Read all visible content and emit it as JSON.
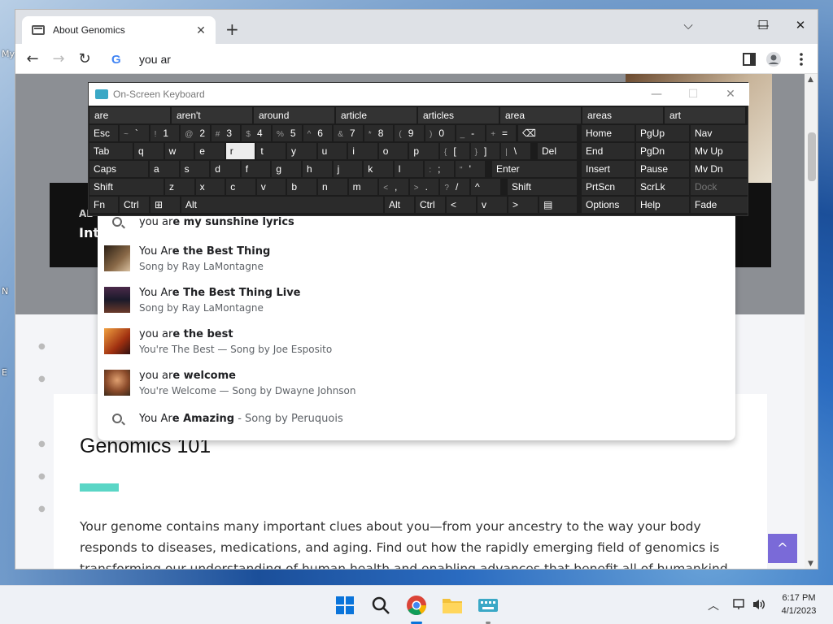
{
  "desktop": {
    "labels": [
      "My",
      "N",
      "E"
    ]
  },
  "browser": {
    "tab_title": "About Genomics",
    "omnibox_text": "you ar"
  },
  "page": {
    "hero_small": "AL",
    "hero_title": "Int",
    "heading": "Genomics 101",
    "body": "Your genome contains many important clues about you—from your ancestry to the way your body responds to diseases, medications, and aging. Find out how the rapidly emerging field of genomics is transforming our understanding of human health and enabling advances that benefit all of humankind."
  },
  "suggestions": [
    {
      "icon": "search-icon",
      "typed": "you ar",
      "rest": "e my sunshine lyrics",
      "sub": ""
    },
    {
      "icon": "thumbnail",
      "typed": "You Ar",
      "rest": "e the Best Thing",
      "sub": "Song by Ray LaMontagne",
      "color": "#6a4a30"
    },
    {
      "icon": "thumbnail",
      "typed": "You Ar",
      "rest": "e The Best Thing Live",
      "sub": "Song by Ray LaMontagne",
      "color": "#3a2a3a"
    },
    {
      "icon": "thumbnail",
      "typed": "you ar",
      "rest": "e the best",
      "sub": "You're The Best — Song by Joe Esposito",
      "color": "#c46a24"
    },
    {
      "icon": "thumbnail",
      "typed": "you ar",
      "rest": "e welcome",
      "sub": "You're Welcome — Song by Dwayne Johnson",
      "color": "#8a5a3a"
    },
    {
      "icon": "search-icon",
      "typed": "You Ar",
      "rest": "e Amazing",
      "inline_sub": " - Song by Peruquois",
      "sub": ""
    }
  ],
  "osk": {
    "title": "On-Screen Keyboard",
    "predictions": [
      "are",
      "aren't",
      "around",
      "article",
      "articles",
      "area",
      "areas",
      "art"
    ],
    "row1": [
      {
        "p": "Esc"
      },
      {
        "s": "~",
        "p": "`"
      },
      {
        "s": "!",
        "p": "1"
      },
      {
        "s": "@",
        "p": "2"
      },
      {
        "s": "#",
        "p": "3"
      },
      {
        "s": "$",
        "p": "4"
      },
      {
        "s": "%",
        "p": "5"
      },
      {
        "s": "^",
        "p": "6"
      },
      {
        "s": "&",
        "p": "7"
      },
      {
        "s": "*",
        "p": "8"
      },
      {
        "s": "(",
        "p": "9"
      },
      {
        "s": ")",
        "p": "0"
      },
      {
        "s": "_",
        "p": "-"
      },
      {
        "s": "+",
        "p": "="
      },
      {
        "p": "⌫"
      }
    ],
    "row2": [
      {
        "p": "Tab"
      },
      {
        "p": "q"
      },
      {
        "p": "w"
      },
      {
        "p": "e"
      },
      {
        "p": "r"
      },
      {
        "p": "t"
      },
      {
        "p": "y"
      },
      {
        "p": "u"
      },
      {
        "p": "i"
      },
      {
        "p": "o"
      },
      {
        "p": "p"
      },
      {
        "s": "{",
        "p": "["
      },
      {
        "s": "}",
        "p": "]"
      },
      {
        "s": "|",
        "p": "\\"
      },
      {
        "p": "Del"
      }
    ],
    "row3": [
      {
        "p": "Caps"
      },
      {
        "p": "a"
      },
      {
        "p": "s"
      },
      {
        "p": "d"
      },
      {
        "p": "f"
      },
      {
        "p": "g"
      },
      {
        "p": "h"
      },
      {
        "p": "j"
      },
      {
        "p": "k"
      },
      {
        "p": "l"
      },
      {
        "s": ":",
        "p": ";"
      },
      {
        "s": "\"",
        "p": "'"
      },
      {
        "p": "Enter"
      }
    ],
    "row4": [
      {
        "p": "Shift"
      },
      {
        "p": "z"
      },
      {
        "p": "x"
      },
      {
        "p": "c"
      },
      {
        "p": "v"
      },
      {
        "p": "b"
      },
      {
        "p": "n"
      },
      {
        "p": "m"
      },
      {
        "s": "<",
        "p": ","
      },
      {
        "s": ">",
        "p": "."
      },
      {
        "s": "?",
        "p": "/"
      },
      {
        "p": "^"
      },
      {
        "p": "Shift"
      }
    ],
    "row5": [
      {
        "p": "Fn"
      },
      {
        "p": "Ctrl"
      },
      {
        "p": "⊞"
      },
      {
        "p": "Alt"
      },
      {
        "p": "Alt"
      },
      {
        "p": "Ctrl"
      },
      {
        "p": "<"
      },
      {
        "p": "v"
      },
      {
        "p": ">"
      },
      {
        "p": "▤"
      }
    ],
    "nav_keys": [
      [
        "Home",
        "PgUp",
        "Nav"
      ],
      [
        "End",
        "PgDn",
        "Mv Up"
      ],
      [
        "Insert",
        "Pause",
        "Mv Dn"
      ],
      [
        "PrtScn",
        "ScrLk",
        "Dock"
      ],
      [
        "Options",
        "Help",
        "Fade"
      ]
    ],
    "highlighted_key": "r"
  },
  "taskbar": {
    "time": "6:17 PM",
    "date": "4/1/2023"
  },
  "colors": {
    "accent": "#5ad6c6",
    "totop": "#7a6ad8"
  }
}
